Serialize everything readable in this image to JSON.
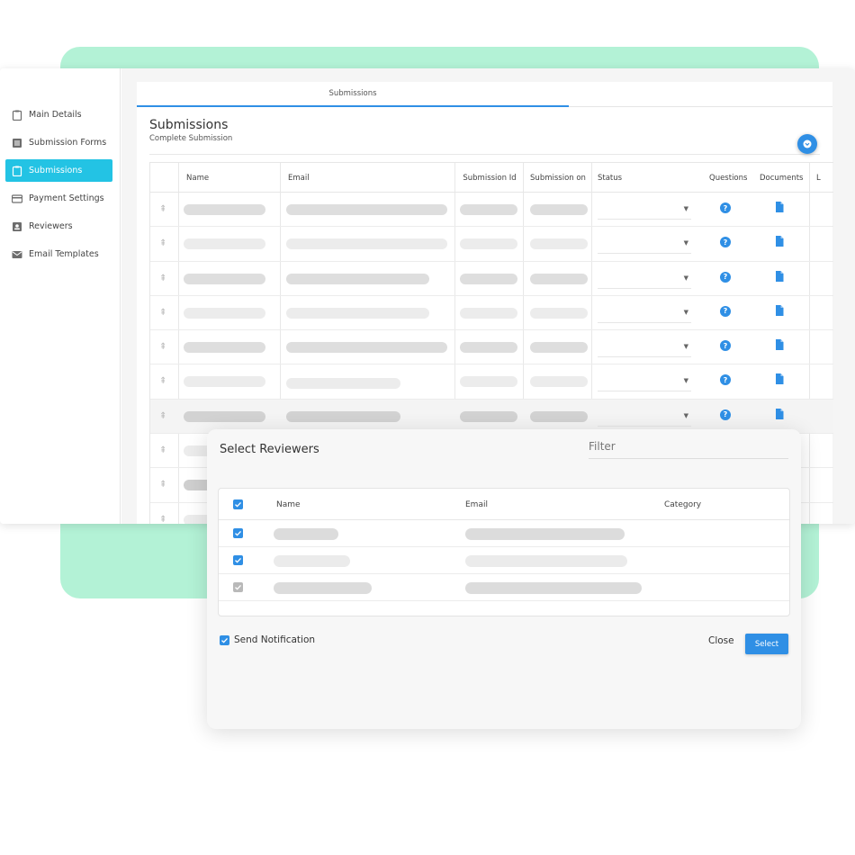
{
  "sidebar": {
    "items": [
      {
        "label": "Main Details",
        "icon": "clipboard-icon",
        "active": false
      },
      {
        "label": "Submission Forms",
        "icon": "list-icon",
        "active": false
      },
      {
        "label": "Submissions",
        "icon": "clipboard-icon",
        "active": true
      },
      {
        "label": "Payment Settings",
        "icon": "credit-card-icon",
        "active": false
      },
      {
        "label": "Reviewers",
        "icon": "id-badge-icon",
        "active": false
      },
      {
        "label": "Email Templates",
        "icon": "envelope-icon",
        "active": false
      }
    ]
  },
  "tabs": [
    {
      "label": "Submissions"
    }
  ],
  "page": {
    "title": "Submissions",
    "subtitle": "Complete Submission"
  },
  "grid": {
    "columns": {
      "name": "Name",
      "email": "Email",
      "submission_id": "Submission Id",
      "submission_on": "Submission on",
      "status": "Status",
      "questions": "Questions",
      "documents": "Documents",
      "last": "L"
    }
  },
  "modal": {
    "title": "Select Reviewers",
    "filter_placeholder": "Filter",
    "columns": {
      "name": "Name",
      "email": "Email",
      "category": "Category"
    },
    "send_notification_label": "Send Notification",
    "send_notification_checked": true,
    "close_label": "Close",
    "select_label": "Select"
  },
  "colors": {
    "accent": "#2f8fe5",
    "sidebar_active": "#23c3e4",
    "backdrop": "#b3f2d6"
  }
}
